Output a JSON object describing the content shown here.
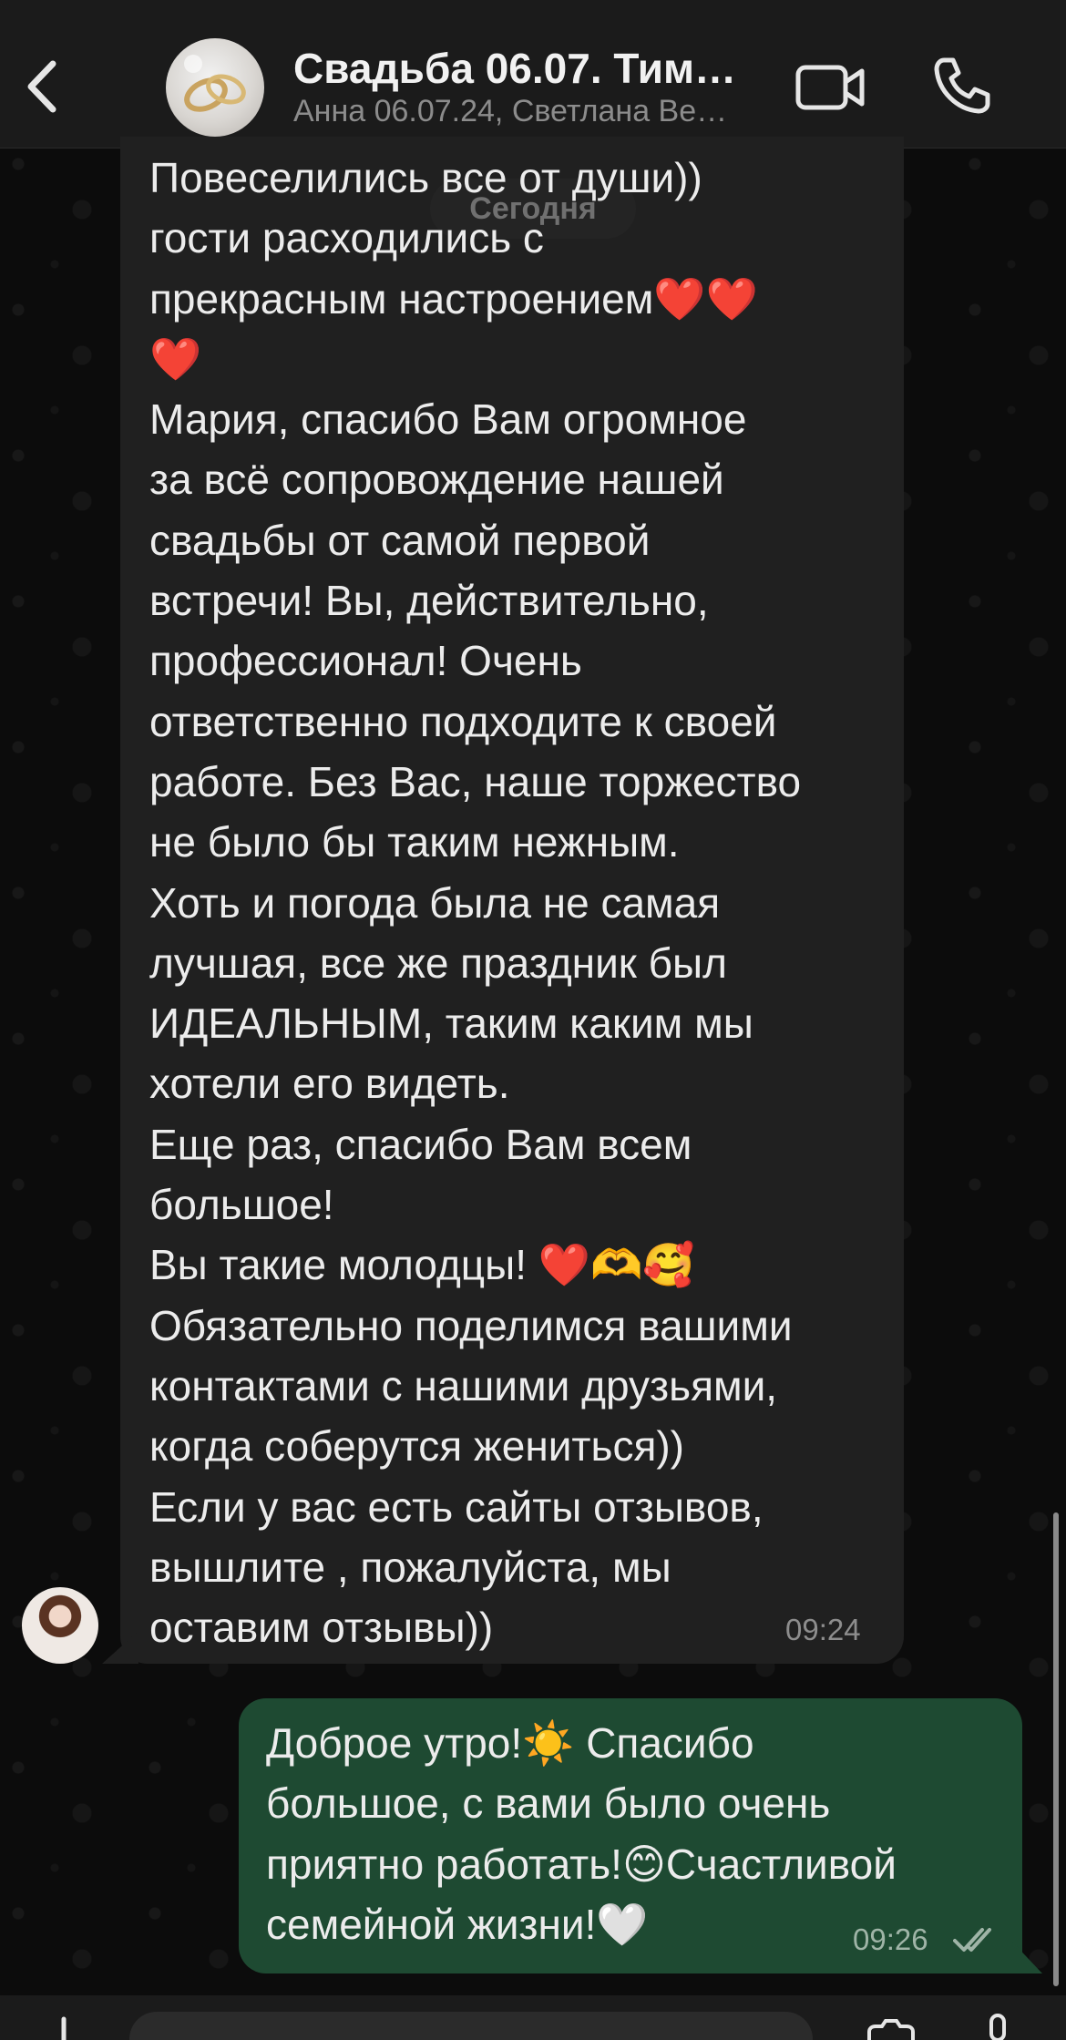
{
  "header": {
    "title": "Свадьба 06.07. Тим…",
    "subtitle": "Анна 06.07.24, Светлана Ве…",
    "back_icon": "chevron-left-icon",
    "video_icon": "video-camera-icon",
    "call_icon": "phone-icon"
  },
  "date_separator": "Сегодня",
  "messages": [
    {
      "direction": "incoming",
      "text": "Повеселились все от души))\nгости расходились с\nпрекрасным настроением❤️❤️\n❤️\nМария, спасибо Вам огромное\nза всё сопровождение нашей\nсвадьбы от самой первой\nвстречи! Вы, действительно,\nпрофессионал! Очень\nответственно подходите к своей\nработе. Без Вас, наше торжество\nне было бы таким нежным.\nХоть и погода была не самая\nлучшая, все же праздник был\nИДЕАЛЬНЫМ, таким каким мы\nхотели его видеть.\nЕще раз, спасибо Вам всем\nбольшое!\nВы такие молодцы! ❤️🫶🥰\nОбязательно поделимся вашими\nконтактами с нашими друзьями,\nкогда соберутся жениться))\nЕсли у вас есть сайты отзывов,\nвышлите , пожалуйста, мы\nоставим отзывы))",
      "time": "09:24"
    },
    {
      "direction": "outgoing",
      "text": "Доброе утро!☀️ Спасибо\nбольшое, с вами было очень\nприятно работать!😊Счастливой\nсемейной жизни!🤍",
      "time": "09:26",
      "status": "read"
    }
  ],
  "colors": {
    "header_bg": "#1b1b1b",
    "incoming_bubble": "#202020",
    "outgoing_bubble": "#1e4a32",
    "read_tick": "#9fb4a7"
  }
}
